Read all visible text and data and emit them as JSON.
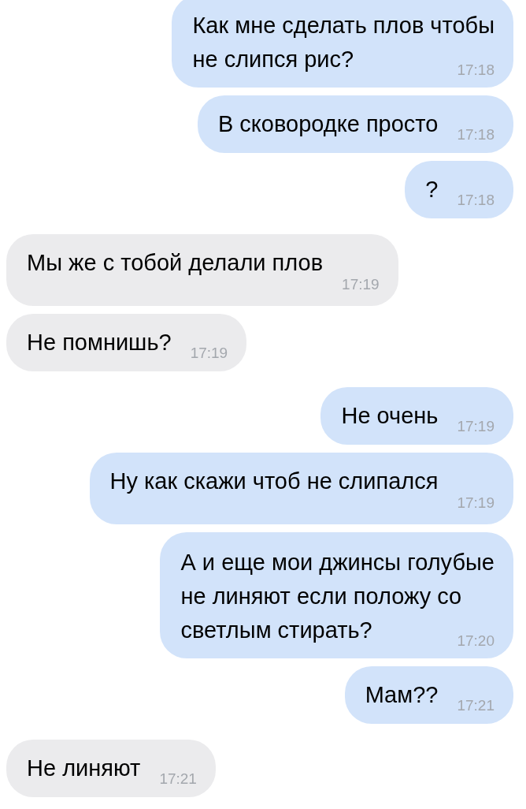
{
  "messages": [
    {
      "kind": "outgoing",
      "lines": [
        "Как мне сделать плов чтобы",
        "не слипся рис?"
      ],
      "time": "17:18",
      "time_below": false
    },
    {
      "kind": "outgoing",
      "lines": [
        "В сковородке просто"
      ],
      "time": "17:18",
      "time_below": false
    },
    {
      "kind": "outgoing",
      "lines": [
        "?"
      ],
      "time": "17:18",
      "time_below": false
    },
    {
      "kind": "incoming",
      "lines": [
        "Мы же с тобой делали плов"
      ],
      "time": "17:19",
      "time_below": true
    },
    {
      "kind": "incoming",
      "lines": [
        "Не помнишь?"
      ],
      "time": "17:19",
      "time_below": false
    },
    {
      "kind": "outgoing",
      "lines": [
        "Не очень"
      ],
      "time": "17:19",
      "time_below": false
    },
    {
      "kind": "outgoing",
      "lines": [
        "Ну как скажи чтоб не слипался"
      ],
      "time": "17:19",
      "time_below": true
    },
    {
      "kind": "outgoing",
      "lines": [
        "А и еще мои джинсы голубые",
        "не линяют если положу со",
        "светлым стирать?"
      ],
      "time": "17:20",
      "time_below": false
    },
    {
      "kind": "outgoing",
      "lines": [
        "Мам??"
      ],
      "time": "17:21",
      "time_below": false
    },
    {
      "kind": "incoming",
      "lines": [
        "Не линяют"
      ],
      "time": "17:21",
      "time_below": false
    }
  ]
}
